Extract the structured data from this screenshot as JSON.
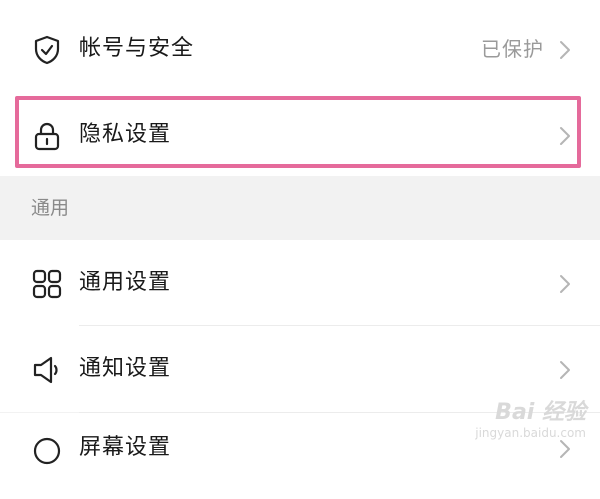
{
  "settings": {
    "rows": [
      {
        "label": "帐号与安全",
        "value": "已保护",
        "icon": "shield-check-icon"
      },
      {
        "label": "隐私设置",
        "icon": "lock-icon"
      },
      {
        "label": "通用设置",
        "icon": "grid-icon"
      },
      {
        "label": "通知设置",
        "icon": "speaker-icon"
      },
      {
        "label": "屏幕设置",
        "icon": "circle-icon"
      }
    ],
    "section_general": "通用"
  },
  "colors": {
    "highlight": "#e56a9b",
    "background": "#f2f2f2",
    "text": "#1a1a1a",
    "muted": "#9a9a9a"
  },
  "watermark": {
    "main": "Bai 经验",
    "sub": "jingyan.baidu.com"
  }
}
